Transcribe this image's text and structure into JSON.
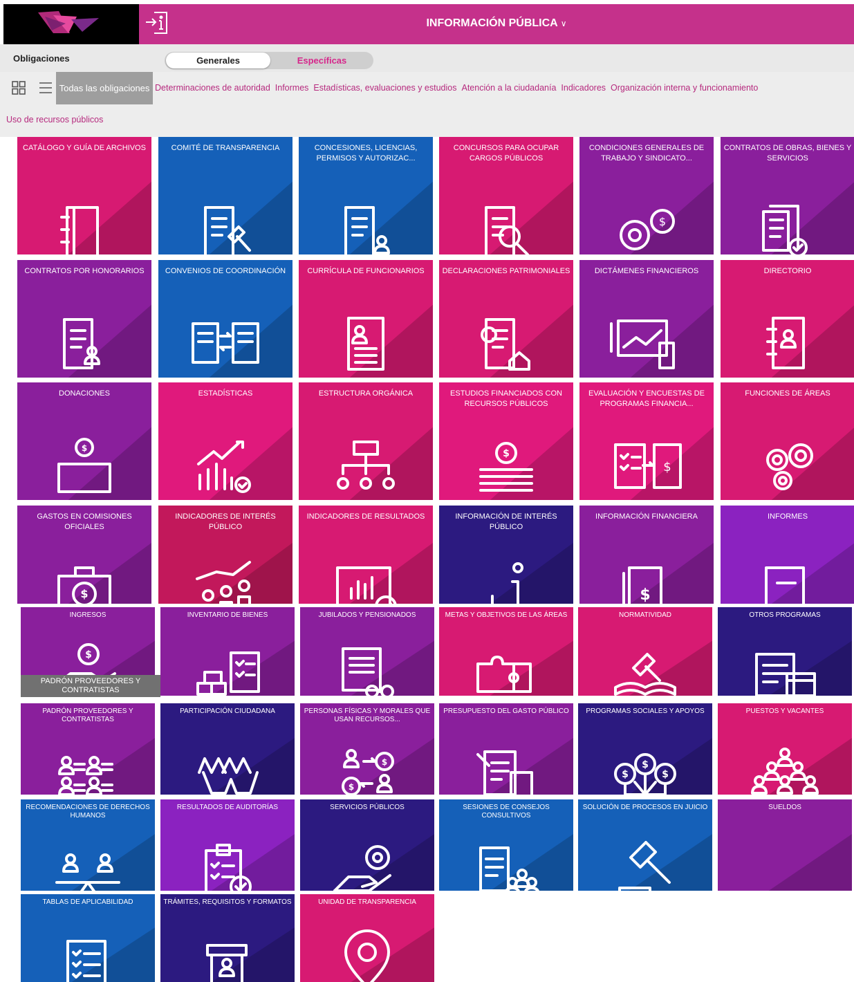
{
  "header": {
    "title": "INFORMACIÓN PÚBLICA",
    "dropdown_icon": "chevron-down-icon",
    "info_icon": "info-door-icon",
    "brand_color": "#c5318b"
  },
  "toolbar": {
    "obligaciones_label": "Obligaciones",
    "toggle_generales": "Generales",
    "toggle_especificas": "Específicas"
  },
  "filters": {
    "active": "Todas las obligaciones",
    "items": [
      "Determinaciones de autoridad",
      "Informes",
      "Estadísticas, evaluaciones y estudios",
      "Atención a la ciudadanía",
      "Indicadores",
      "Organización interna y funcionamiento"
    ],
    "item2": "Uso de recursos públicos",
    "view_icons": [
      "grid-view-icon",
      "list-view-icon"
    ]
  },
  "tooltip": "PADRÓN PROVEEDORES Y CONTRATISTAS",
  "tiles": [
    {
      "label": "CATÁLOGO Y GUÍA DE ARCHIVOS",
      "color": "#d71a72",
      "icon": "binder-icon"
    },
    {
      "label": "COMITÉ DE TRANSPARENCIA",
      "color": "#1560b8",
      "icon": "document-gavel-icon"
    },
    {
      "label": "CONCESIONES, LICENCIAS, PERMISOS Y AUTORIZAC...",
      "color": "#1560b8",
      "icon": "signed-document-user-icon"
    },
    {
      "label": "CONCURSOS PARA OCUPAR CARGOS PÚBLICOS",
      "color": "#d71a72",
      "icon": "profile-search-icon"
    },
    {
      "label": "CONDICIONES GENERALES DE TRABAJO Y SINDICATO...",
      "color": "#8a1f9c",
      "icon": "gears-user-money-icon"
    },
    {
      "label": "CONTRATOS DE OBRAS, BIENES Y SERVICIOS",
      "color": "#8a1f9c",
      "icon": "documents-check-icon"
    },
    {
      "label": "CONTRATOS POR HONORARIOS",
      "color": "#8a1f9c",
      "icon": "document-user-icon"
    },
    {
      "label": "CONVENIOS DE COORDINACIÓN",
      "color": "#1560b8",
      "icon": "exchange-documents-icon"
    },
    {
      "label": "CURRÍCULA DE FUNCIONARIOS",
      "color": "#d71a72",
      "icon": "resume-icon"
    },
    {
      "label": "DECLARACIONES PATRIMONIALES",
      "color": "#d71a72",
      "icon": "document-eye-house-icon"
    },
    {
      "label": "DICTÁMENES FINANCIEROS",
      "color": "#8a1f9c",
      "icon": "chart-calculator-icon"
    },
    {
      "label": "DIRECTORIO",
      "color": "#d71a72",
      "icon": "address-book-icon"
    },
    {
      "label": "DONACIONES",
      "color": "#8a1f9c",
      "icon": "donation-box-icon"
    },
    {
      "label": "ESTADÍSTICAS",
      "color": "#e0197c",
      "icon": "bar-chart-check-icon"
    },
    {
      "label": "ESTRUCTURA ORGÁNICA",
      "color": "#d71a72",
      "icon": "org-chart-icon"
    },
    {
      "label": "ESTUDIOS FINANCIADOS CON RECURSOS PÚBLICOS",
      "color": "#e0197c",
      "icon": "coin-books-icon"
    },
    {
      "label": "EVALUACIÓN Y ENCUESTAS DE PROGRAMAS FINANCIA...",
      "color": "#e0197c",
      "icon": "checklist-money-icon"
    },
    {
      "label": "FUNCIONES DE ÁREAS",
      "color": "#d71a72",
      "icon": "gears-icon"
    },
    {
      "label": "GASTOS EN COMISIONES OFICIALES",
      "color": "#8a1f9c",
      "icon": "money-briefcase-icon"
    },
    {
      "label": "INDICADORES DE INTERÉS PÚBLICO",
      "color": "#c2185b",
      "icon": "growth-people-icon"
    },
    {
      "label": "INDICADORES DE RESULTADOS",
      "color": "#d71a72",
      "icon": "chart-check-icon"
    },
    {
      "label": "INFORMACIÓN DE INTERÉS PÚBLICO",
      "color": "#2c1a80",
      "icon": "plus-info-icon"
    },
    {
      "label": "INFORMACIÓN FINANCIERA",
      "color": "#8a1f9c",
      "icon": "money-book-icon"
    },
    {
      "label": "INFORMES",
      "color": "#8b22c0",
      "icon": "report-icon"
    },
    {
      "label": "INGRESOS",
      "color": "#8a1f9c",
      "icon": "hand-coin-icon"
    },
    {
      "label": "INVENTARIO DE BIENES",
      "color": "#8a1f9c",
      "icon": "inventory-boxes-icon"
    },
    {
      "label": "JUBILADOS Y PENSIONADOS",
      "color": "#8a1f9c",
      "icon": "document-glasses-icon"
    },
    {
      "label": "METAS Y OBJETIVOS DE LAS ÁREAS",
      "color": "#d71a72",
      "icon": "puzzle-icon"
    },
    {
      "label": "NORMATIVIDAD",
      "color": "#d71a72",
      "icon": "law-book-icon"
    },
    {
      "label": "OTROS PROGRAMAS",
      "color": "#2c1a80",
      "icon": "document-calendar-icon"
    },
    {
      "label": "PADRÓN PROVEEDORES Y CONTRATISTAS",
      "color": "#8a1f9c",
      "icon": "people-list-icon"
    },
    {
      "label": "PARTICIPACIÓN CIUDADANA",
      "color": "#2c1a80",
      "icon": "raised-hands-icon"
    },
    {
      "label": "PERSONAS FÍSICAS Y MORALES QUE USAN RECURSOS...",
      "color": "#8a1f9c",
      "icon": "people-money-exchange-icon"
    },
    {
      "label": "PRESUPUESTO DEL GASTO PÚBLICO",
      "color": "#8a1f9c",
      "icon": "budget-calculator-icon"
    },
    {
      "label": "PROGRAMAS SOCIALES Y APOYOS",
      "color": "#2c1a80",
      "icon": "money-tree-icon"
    },
    {
      "label": "PUESTOS Y VACANTES",
      "color": "#d71a72",
      "icon": "team-icon"
    },
    {
      "label": "RECOMENDACIONES DE DERECHOS HUMANOS",
      "color": "#1560b8",
      "icon": "balance-people-icon"
    },
    {
      "label": "RESULTADOS DE AUDITORÍAS",
      "color": "#8b22c0",
      "icon": "clipboard-check-icon"
    },
    {
      "label": "SERVICIOS PÚBLICOS",
      "color": "#2c1a80",
      "icon": "hand-gear-icon"
    },
    {
      "label": "SESIONES DE CONSEJOS CONSULTIVOS",
      "color": "#1560b8",
      "icon": "documents-group-icon"
    },
    {
      "label": "SOLUCIÓN DE PROCESOS EN JUICIO",
      "color": "#1560b8",
      "icon": "gavel-icon"
    },
    {
      "label": "SUELDOS",
      "color": "#8a1f9c",
      "icon": "banknotes-icon"
    },
    {
      "label": "TABLAS DE APLICABILIDAD",
      "color": "#1560b8",
      "icon": "checklist-icon"
    },
    {
      "label": "TRÁMITES, REQUISITOS Y FORMATOS",
      "color": "#2c1a80",
      "icon": "desk-user-icon"
    },
    {
      "label": "UNIDAD DE TRANSPARENCIA",
      "color": "#d71a72",
      "icon": "location-pin-icon"
    }
  ]
}
